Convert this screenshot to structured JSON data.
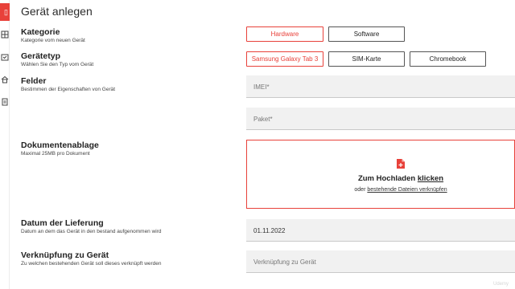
{
  "page": {
    "title": "Gerät anlegen"
  },
  "sections": {
    "kategorie": {
      "heading": "Kategorie",
      "sub": "Kategorie vom neuen Gerät"
    },
    "geraetetyp": {
      "heading": "Gerätetyp",
      "sub": "Wählen Sie den Typ vom Gerät"
    },
    "felder": {
      "heading": "Felder",
      "sub": "Bestimmen der Eigenschaften von Gerät"
    },
    "dokumente": {
      "heading": "Dokumentenablage",
      "sub": "Maximal 25MB pro Dokument"
    },
    "lieferung": {
      "heading": "Datum der Lieferung",
      "sub": "Datum an dem das Gerät in den bestand aufgenommen wird"
    },
    "verknuepfung": {
      "heading": "Verknüpfung zu Gerät",
      "sub": "Zu welchen bestehenden Gerät soll dieses verknüpft werden"
    }
  },
  "kategorie_options": [
    {
      "label": "Hardware",
      "selected": true
    },
    {
      "label": "Software",
      "selected": false
    }
  ],
  "typ_options": [
    {
      "label": "Samsung Galaxy Tab 3",
      "selected": true
    },
    {
      "label": "SIM-Karte",
      "selected": false
    },
    {
      "label": "Chromebook",
      "selected": false
    }
  ],
  "fields": {
    "imei": {
      "placeholder": "IMEI*"
    },
    "paket": {
      "placeholder": "Paket*"
    },
    "lieferdatum": {
      "value": "01.11.2022"
    },
    "verknuepfung": {
      "placeholder": "Verknüpfung zu Gerät"
    }
  },
  "upload": {
    "line1_prefix": "Zum Hochladen ",
    "line1_link": "klicken",
    "line2_prefix": "oder ",
    "line2_link": "bestehende Dateien verknüpfen"
  },
  "watermark": "Udemy",
  "colors": {
    "accent": "#e8413a"
  },
  "rail_icons": [
    "app-logo-icon",
    "grid-icon",
    "device-check-icon",
    "home-icon",
    "document-icon"
  ]
}
